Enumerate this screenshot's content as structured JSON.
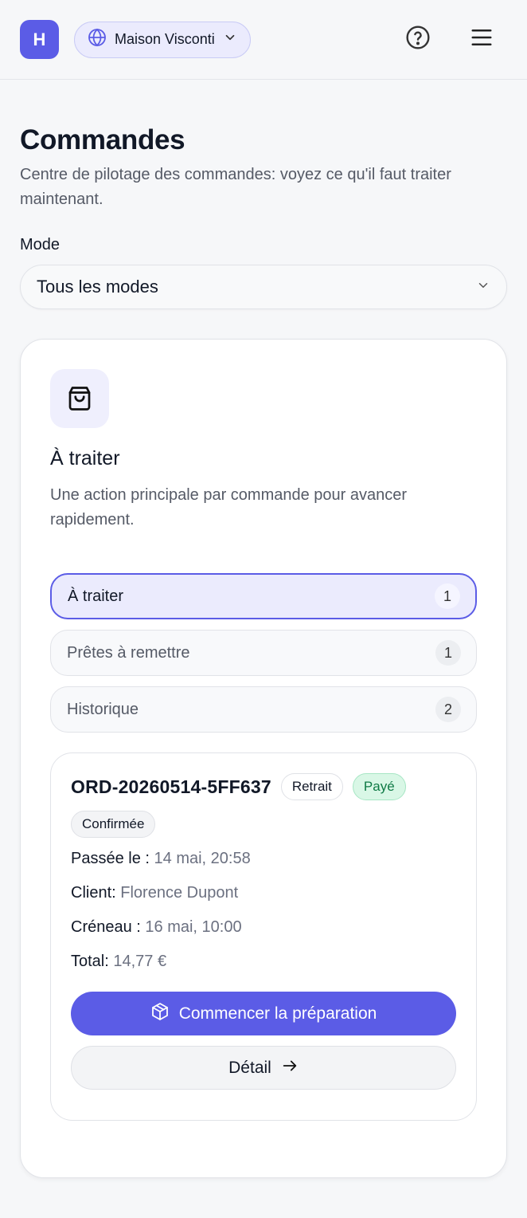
{
  "header": {
    "logo_letter": "H",
    "organization": "Maison Visconti",
    "accent_color": "#5b5ce6"
  },
  "page": {
    "title": "Commandes",
    "subtitle": "Centre de pilotage des commandes: voyez ce qu'il faut traiter maintenant."
  },
  "filter": {
    "label": "Mode",
    "selected": "Tous les modes"
  },
  "section": {
    "title": "À traiter",
    "subtitle": "Une action principale par commande pour avancer rapidement.",
    "tabs": [
      {
        "label": "À traiter",
        "count": "1",
        "active": true
      },
      {
        "label": "Prêtes à remettre",
        "count": "1",
        "active": false
      },
      {
        "label": "Historique",
        "count": "2",
        "active": false
      }
    ]
  },
  "order": {
    "id": "ORD-20260514-5FF637",
    "chips": {
      "mode": "Retrait",
      "payment": "Payé",
      "status": "Confirmée"
    },
    "fields": [
      {
        "key": "Passée le :",
        "value": "14 mai, 20:58"
      },
      {
        "key": "Client:",
        "value": "Florence Dupont"
      },
      {
        "key": "Créneau :",
        "value": "16 mai, 10:00"
      },
      {
        "key": "Total:",
        "value": "14,77 €"
      }
    ],
    "primary_action": "Commencer la préparation",
    "secondary_action": "Détail"
  }
}
